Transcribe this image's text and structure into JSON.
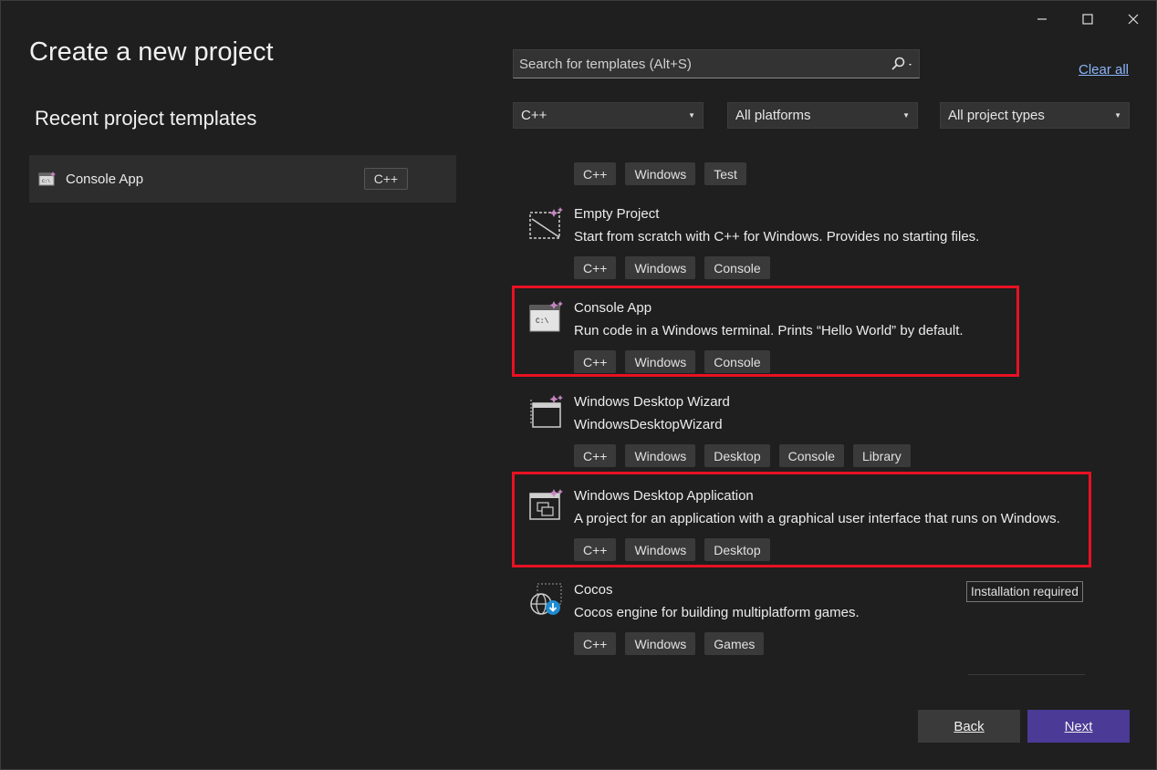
{
  "window": {
    "minimize_icon": "minimize-icon",
    "maximize_icon": "maximize-icon",
    "close_icon": "close-icon"
  },
  "title": "Create a new project",
  "recent": {
    "heading": "Recent project templates",
    "items": [
      {
        "label": "Console App",
        "tag": "C++"
      }
    ]
  },
  "search": {
    "placeholder": "Search for templates (Alt+S)"
  },
  "clear_all": "Clear all",
  "filters": {
    "language": "C++",
    "platform": "All platforms",
    "project_type": "All project types"
  },
  "templates": [
    {
      "name": "",
      "description": "",
      "tags": [
        "C++",
        "Windows",
        "Test"
      ]
    },
    {
      "name": "Empty Project",
      "description": "Start from scratch with C++ for Windows. Provides no starting files.",
      "tags": [
        "C++",
        "Windows",
        "Console"
      ]
    },
    {
      "name": "Console App",
      "description": "Run code in a Windows terminal. Prints “Hello World” by default.",
      "tags": [
        "C++",
        "Windows",
        "Console"
      ]
    },
    {
      "name": "Windows Desktop Wizard",
      "description": "WindowsDesktopWizard",
      "tags": [
        "C++",
        "Windows",
        "Desktop",
        "Console",
        "Library"
      ]
    },
    {
      "name": "Windows Desktop Application",
      "description": "A project for an application with a graphical user interface that runs on Windows.",
      "tags": [
        "C++",
        "Windows",
        "Desktop"
      ]
    },
    {
      "name": "Cocos",
      "description": "Cocos engine for building multiplatform games.",
      "tags": [
        "C++",
        "Windows",
        "Games"
      ],
      "badge": "Installation required"
    }
  ],
  "buttons": {
    "back": "Back",
    "next": "Next"
  },
  "colors": {
    "accent": "#4b3a96",
    "highlight": "#e81123",
    "link": "#8ab4f8"
  }
}
